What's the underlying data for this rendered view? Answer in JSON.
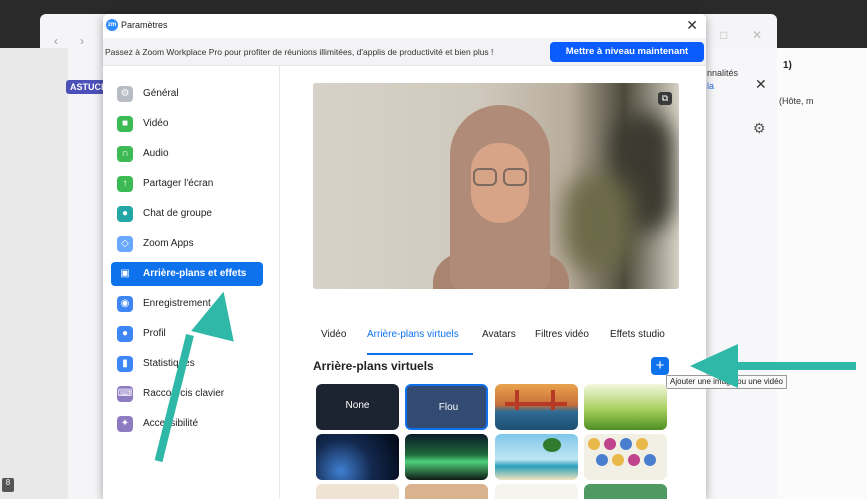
{
  "background": {
    "astuce": "ASTUCE",
    "right_text1": "nnalités",
    "right_text2": "la",
    "far_text1": "1)",
    "far_text2": "(Hôte, m",
    "corner_badge": "8"
  },
  "dialog": {
    "title": "Paramètres",
    "logo_text": "zm",
    "promo_text": "Passez à Zoom Workplace Pro pour profiter de réunions illimitées, d'applis de productivité et bien plus !",
    "upgrade_label": "Mettre à niveau maintenant"
  },
  "sidebar": {
    "items": [
      {
        "label": "Général",
        "color": "#b8bcc4"
      },
      {
        "label": "Vidéo",
        "color": "#3cba54"
      },
      {
        "label": "Audio",
        "color": "#3cba54"
      },
      {
        "label": "Partager l'écran",
        "color": "#3cba54"
      },
      {
        "label": "Chat de groupe",
        "color": "#23a6a6"
      },
      {
        "label": "Zoom Apps",
        "color": "#6aa7ff"
      },
      {
        "label": "Arrière-plans et effets",
        "color": "#0e72ed"
      },
      {
        "label": "Enregistrement",
        "color": "#3f86f5"
      },
      {
        "label": "Profil",
        "color": "#3f86f5"
      },
      {
        "label": "Statistiques",
        "color": "#3f86f5"
      },
      {
        "label": "Raccourcis clavier",
        "color": "#8e7cc3"
      },
      {
        "label": "Accessibilité",
        "color": "#8e7cc3"
      }
    ]
  },
  "tabs": [
    "Vidéo",
    "Arrière-plans virtuels",
    "Avatars",
    "Filtres vidéo",
    "Effets studio"
  ],
  "section": {
    "title": "Arrière-plans virtuels",
    "add_tooltip": "Ajouter une image ou une vidéo"
  },
  "backgrounds": [
    {
      "label": "None"
    },
    {
      "label": "Flou"
    },
    {
      "label": ""
    },
    {
      "label": ""
    },
    {
      "label": ""
    },
    {
      "label": ""
    },
    {
      "label": ""
    },
    {
      "label": ""
    }
  ],
  "colors": {
    "accent": "#0e72ed",
    "upgrade": "#0b5cff",
    "annotation_arrow": "#2fb8a8"
  }
}
